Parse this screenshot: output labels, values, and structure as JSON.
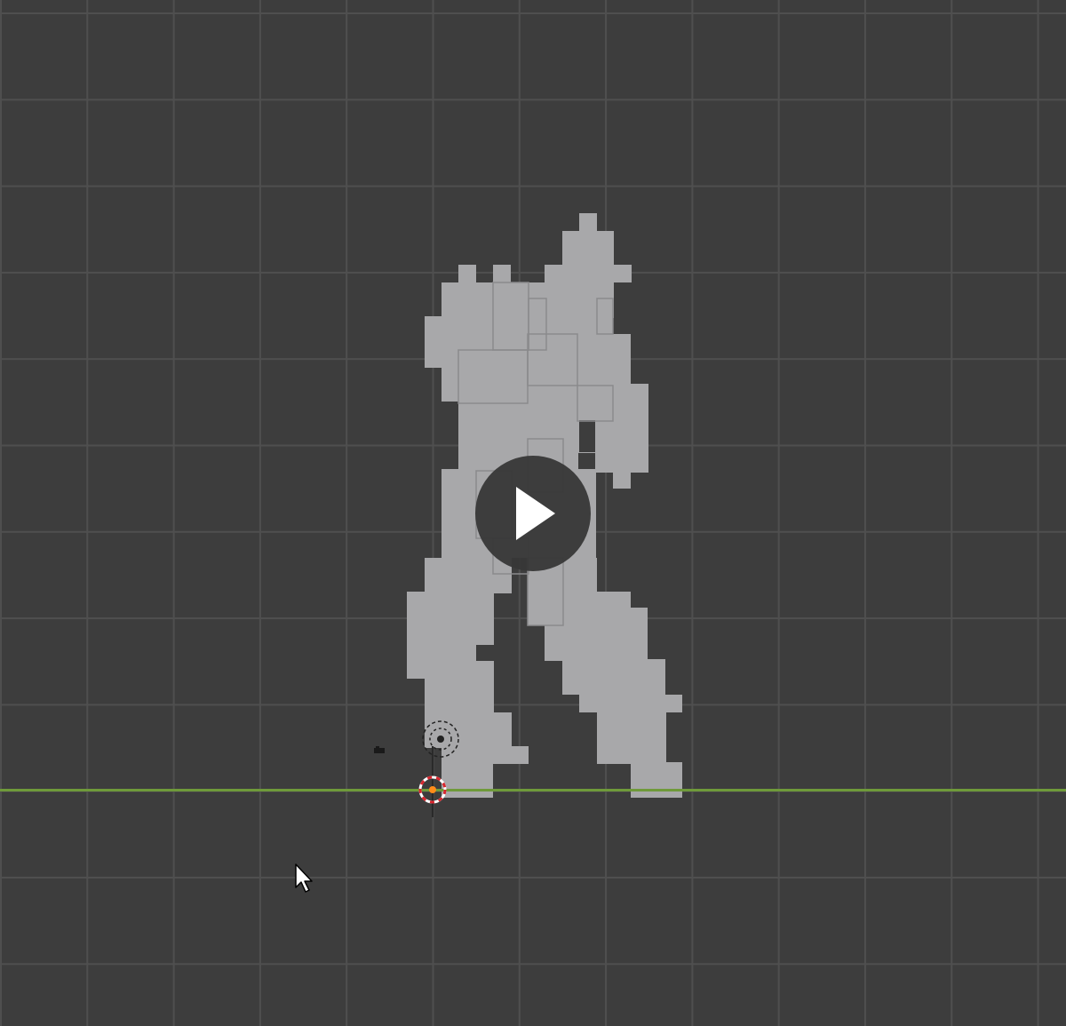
{
  "viewport": {
    "background_color": "#3d3d3d",
    "grid_color": "#4f4f4f",
    "ground_axis_color": "#6f9a3a"
  },
  "scene": {
    "figure_fill": "#a8a8aa",
    "figure_edge": "#8a8a8c"
  },
  "video_overlay": {
    "play_icon": "play-icon"
  },
  "gizmos": {
    "origin_icon": "origin-icon",
    "camera_icon": "camera-icon",
    "cursor_icon": "mouse-cursor-icon"
  }
}
